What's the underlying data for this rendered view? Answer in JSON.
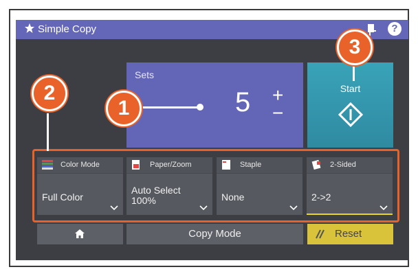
{
  "header": {
    "title": "Simple Copy",
    "icons": [
      "star-icon",
      "document-icon",
      "help-icon"
    ],
    "help_glyph": "?"
  },
  "sets": {
    "label": "Sets",
    "value": "5",
    "plus": "+",
    "minus": "−"
  },
  "start": {
    "label": "Start"
  },
  "functions": [
    {
      "title": "Color Mode",
      "value_line1": "Full Color",
      "value_line2": "",
      "icon": "color-mode-icon"
    },
    {
      "title": "Paper/Zoom",
      "value_line1": "Auto Select",
      "value_line2": "100%",
      "icon": "paper-zoom-icon"
    },
    {
      "title": "Staple",
      "value_line1": "None",
      "value_line2": "",
      "icon": "staple-icon"
    },
    {
      "title": "2-Sided",
      "value_line1": "2->2",
      "value_line2": "",
      "icon": "two-sided-icon"
    }
  ],
  "bottom": {
    "copy_mode_label": "Copy Mode",
    "reset_label": "Reset"
  },
  "callouts": [
    "1",
    "2",
    "3"
  ],
  "colors": {
    "accent_purple": "#6365b6",
    "start_teal": "#39a3b8",
    "reset_yellow": "#d9c33a",
    "callout_orange": "#e8622a"
  }
}
